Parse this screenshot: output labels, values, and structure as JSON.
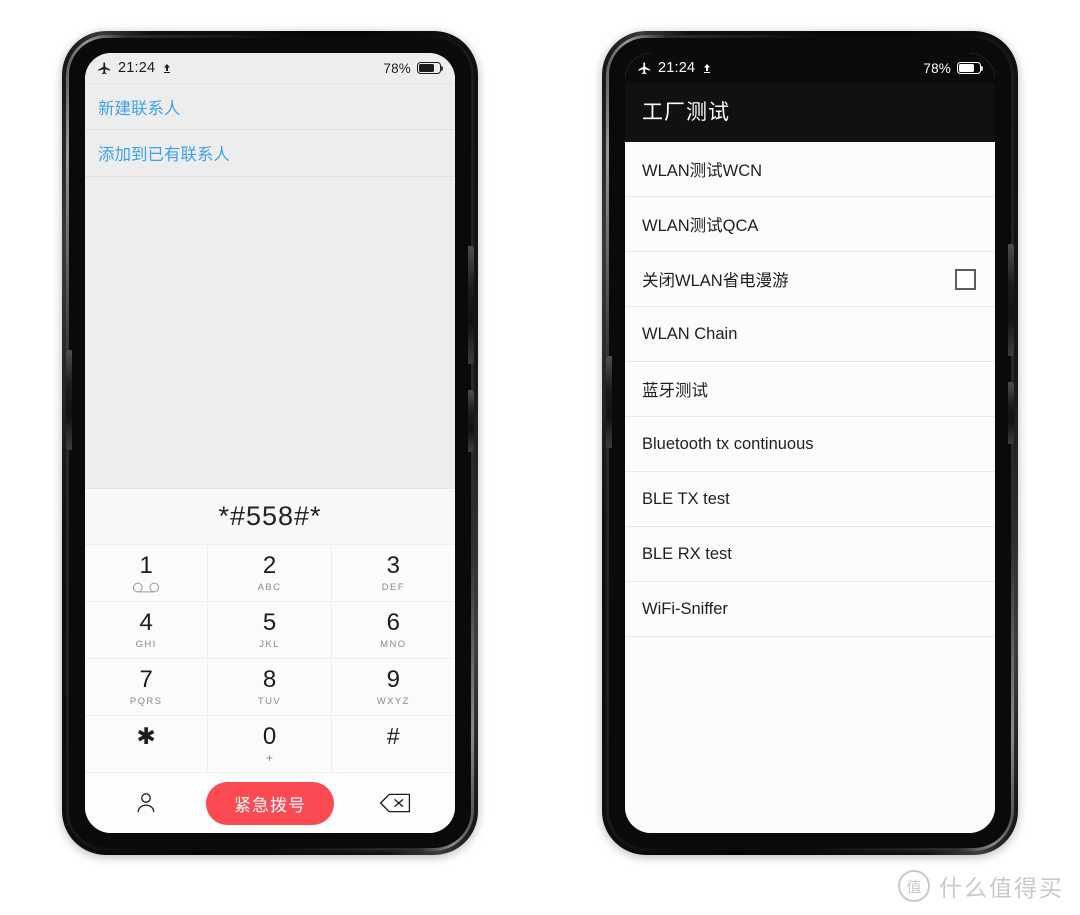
{
  "status_bar": {
    "airplane_icon": "airplane-mode-icon",
    "time": "21:24",
    "upload_icon": "upload-arrow-icon",
    "battery_percent": "78%",
    "battery_icon": "battery-icon",
    "battery_level": 78
  },
  "left_phone": {
    "contact_actions": [
      {
        "label": "新建联系人"
      },
      {
        "label": "添加到已有联系人"
      }
    ],
    "dialed_number": "*#558#*",
    "keypad": [
      {
        "digit": "1",
        "sub": "",
        "icon": "voicemail-icon"
      },
      {
        "digit": "2",
        "sub": "ABC",
        "icon": ""
      },
      {
        "digit": "3",
        "sub": "DEF",
        "icon": ""
      },
      {
        "digit": "4",
        "sub": "GHI",
        "icon": ""
      },
      {
        "digit": "5",
        "sub": "JKL",
        "icon": ""
      },
      {
        "digit": "6",
        "sub": "MNO",
        "icon": ""
      },
      {
        "digit": "7",
        "sub": "PQRS",
        "icon": ""
      },
      {
        "digit": "8",
        "sub": "TUV",
        "icon": ""
      },
      {
        "digit": "9",
        "sub": "WXYZ",
        "icon": ""
      },
      {
        "digit": "✱",
        "sub": "",
        "icon": ""
      },
      {
        "digit": "0",
        "sub": "+",
        "icon": ""
      },
      {
        "digit": "#",
        "sub": "",
        "icon": ""
      }
    ],
    "actions": {
      "contacts_icon": "contacts-person-icon",
      "call_label": "紧急拨号",
      "call_color": "#fb4a52",
      "backspace_icon": "backspace-icon"
    },
    "link_color": "#3ea2e8"
  },
  "right_phone": {
    "title": "工厂测试",
    "items": [
      {
        "label": "WLAN测试WCN",
        "checkbox": false
      },
      {
        "label": "WLAN测试QCA",
        "checkbox": false
      },
      {
        "label": "关闭WLAN省电漫游",
        "checkbox": true,
        "checked": false
      },
      {
        "label": "WLAN Chain",
        "checkbox": false
      },
      {
        "label": "蓝牙测试",
        "checkbox": false
      },
      {
        "label": "Bluetooth tx continuous",
        "checkbox": false
      },
      {
        "label": "BLE TX test",
        "checkbox": false
      },
      {
        "label": "BLE RX test",
        "checkbox": false
      },
      {
        "label": "WiFi-Sniffer",
        "checkbox": false
      }
    ],
    "header_bg": "#111111"
  },
  "watermark": {
    "logo_char": "值",
    "text": "什么值得买"
  }
}
